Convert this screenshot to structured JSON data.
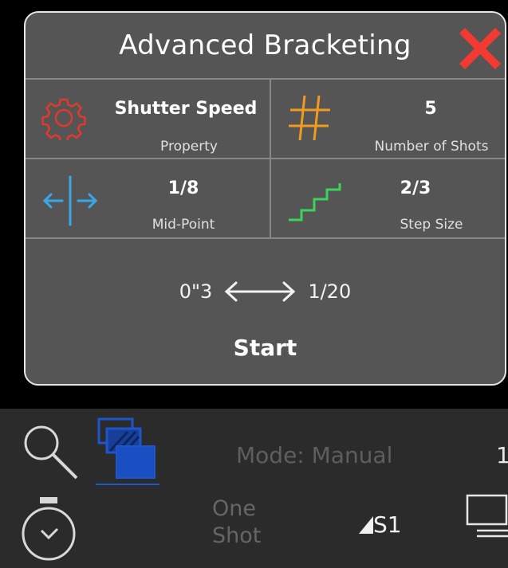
{
  "dialog": {
    "title": "Advanced Bracketing",
    "close_icon": "close-x-icon",
    "cells": [
      {
        "value": "Shutter Speed",
        "caption": "Property",
        "icon": "gear-icon",
        "icon_color": "#e03a2f"
      },
      {
        "value": "5",
        "caption": "Number of Shots",
        "icon": "hash-icon",
        "icon_color": "#f29a1f"
      },
      {
        "value": "1/8",
        "caption": "Mid-Point",
        "icon": "midpoint-icon",
        "icon_color": "#3aa8e8"
      },
      {
        "value": "2/3",
        "caption": "Step Size",
        "icon": "stairs-icon",
        "icon_color": "#3dd25a"
      }
    ],
    "range_from": "0\"3",
    "range_to": "1/20",
    "start_label": "Start"
  },
  "bottom": {
    "mode_text": "Mode: Manual",
    "edge_value": "1",
    "shot_mode": "One Shot",
    "s1_label": "S1",
    "icons": [
      "magnifier-icon",
      "bracketing-icon",
      "timer-icon",
      "metering-icon",
      "display-icon"
    ],
    "accent": "#1e55c8"
  }
}
